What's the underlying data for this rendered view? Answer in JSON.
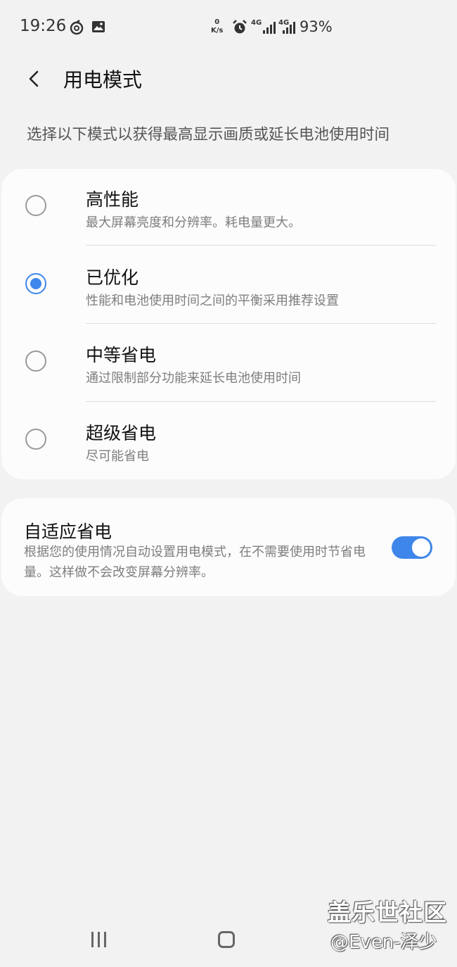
{
  "status_bar": {
    "time": "19:26",
    "speed_value": "0",
    "speed_unit": "K/s",
    "network_1": "4G",
    "network_2": "4G",
    "battery": "93%"
  },
  "header": {
    "title": "用电模式"
  },
  "description": "选择以下模式以获得最高显示画质或延长电池使用时间",
  "modes": [
    {
      "title": "高性能",
      "subtitle": "最大屏幕亮度和分辨率。耗电量更大。",
      "selected": false
    },
    {
      "title": "已优化",
      "subtitle": "性能和电池使用时间之间的平衡采用推荐设置",
      "selected": true
    },
    {
      "title": "中等省电",
      "subtitle": "通过限制部分功能来延长电池使用时间",
      "selected": false
    },
    {
      "title": "超级省电",
      "subtitle": "尽可能省电",
      "selected": false
    }
  ],
  "adaptive": {
    "title": "自适应省电",
    "subtitle": "根据您的使用情况自动设置用电模式，在不需要使用时节省电量。这样做不会改变屏幕分辨率。",
    "enabled": true
  },
  "watermark": {
    "line1": "盖乐世社区",
    "line2": "@Even-泽少"
  },
  "colors": {
    "accent": "#3f86ea",
    "background": "#f2f2f2",
    "card": "#fcfcfc"
  }
}
